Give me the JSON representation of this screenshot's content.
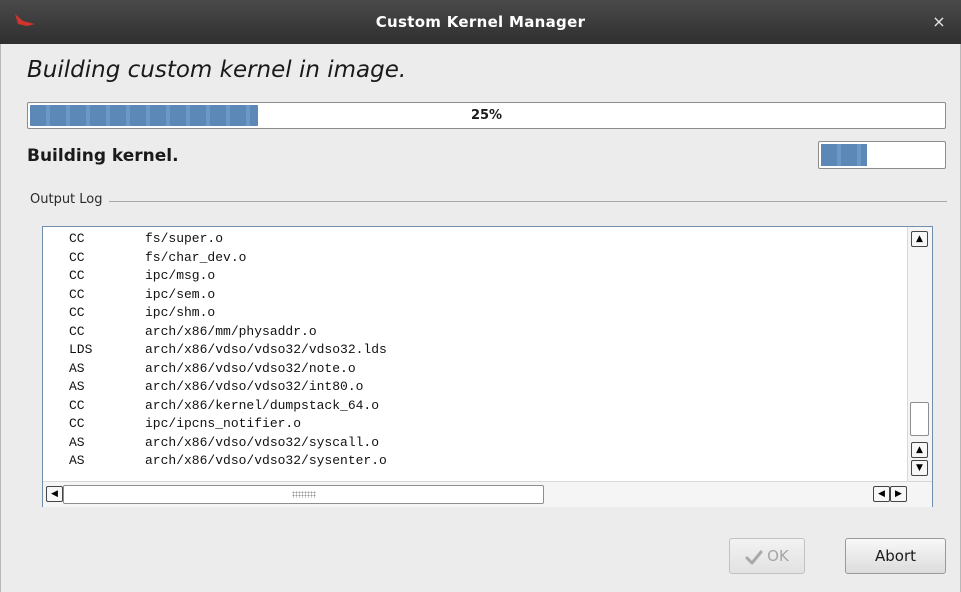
{
  "window": {
    "title": "Custom Kernel Manager",
    "close_glyph": "×",
    "logo_icon": "app-logo-icon"
  },
  "heading": "Building custom kernel in image.",
  "progress": {
    "percent_label": "25%",
    "fraction": 0.25
  },
  "step": {
    "label": "Building kernel.",
    "indicator_state": "indeterminate"
  },
  "output_log": {
    "legend": "Output Log",
    "rows": [
      {
        "type": "CC",
        "path": "fs/super.o"
      },
      {
        "type": "CC",
        "path": "fs/char_dev.o"
      },
      {
        "type": "CC",
        "path": "ipc/msg.o"
      },
      {
        "type": "CC",
        "path": "ipc/sem.o"
      },
      {
        "type": "CC",
        "path": "ipc/shm.o"
      },
      {
        "type": "CC",
        "path": "arch/x86/mm/physaddr.o"
      },
      {
        "type": "LDS",
        "path": "arch/x86/vdso/vdso32/vdso32.lds"
      },
      {
        "type": "AS",
        "path": "arch/x86/vdso/vdso32/note.o"
      },
      {
        "type": "AS",
        "path": "arch/x86/vdso/vdso32/int80.o"
      },
      {
        "type": "CC",
        "path": "arch/x86/kernel/dumpstack_64.o"
      },
      {
        "type": "CC",
        "path": "ipc/ipcns_notifier.o"
      },
      {
        "type": "AS",
        "path": "arch/x86/vdso/vdso32/syscall.o"
      },
      {
        "type": "AS",
        "path": "arch/x86/vdso/vdso32/sysenter.o"
      }
    ]
  },
  "buttons": {
    "ok_label": "OK",
    "ok_enabled": false,
    "abort_label": "Abort"
  },
  "colors": {
    "progress_fill": "#5b88b6",
    "titlebar": "#3a3a3a"
  }
}
